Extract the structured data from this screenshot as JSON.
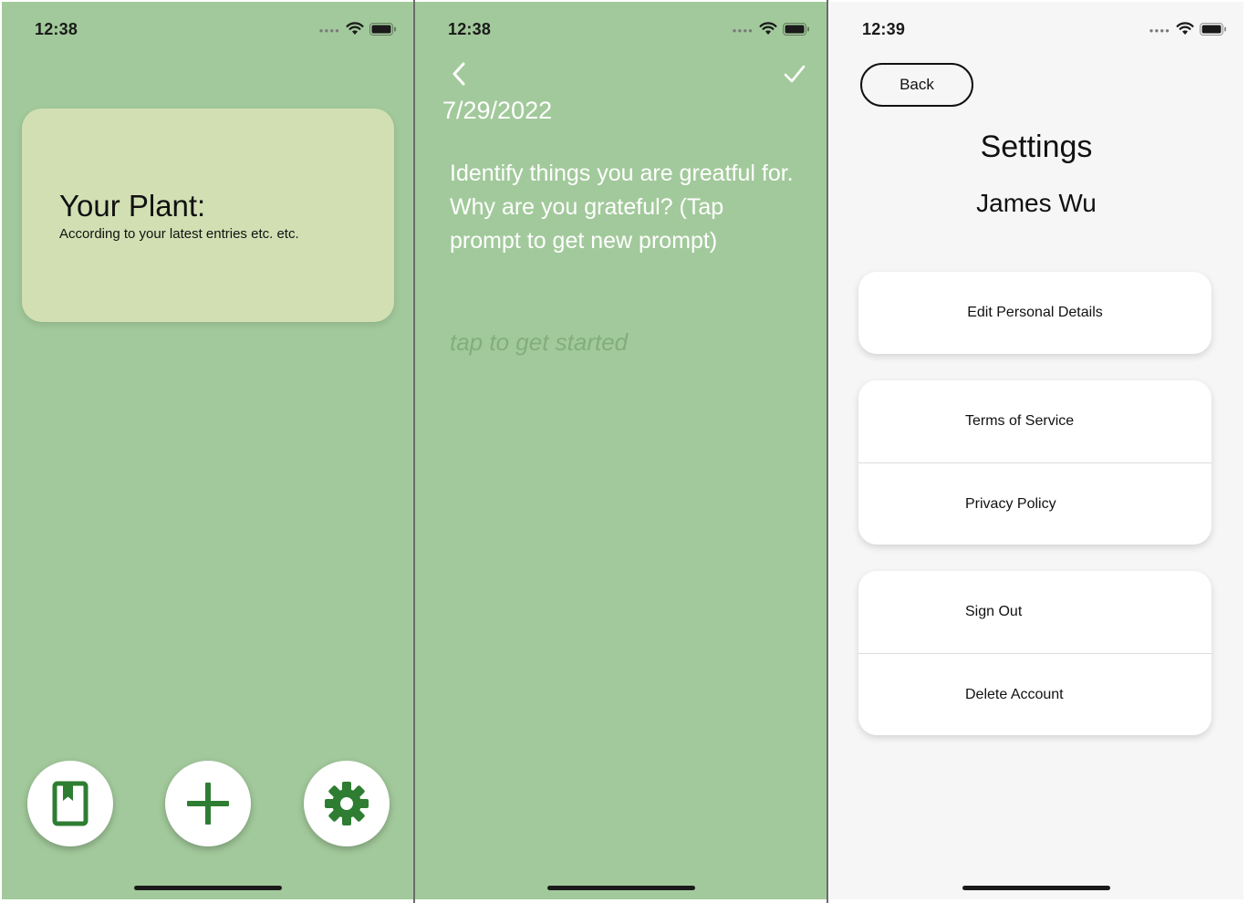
{
  "home_screen": {
    "status_time": "12:38",
    "plant_card": {
      "title": "Your Plant:",
      "subtitle": "According to your latest entries etc. etc."
    },
    "fabs": [
      {
        "icon": "bookmark-book-icon"
      },
      {
        "icon": "plus-icon"
      },
      {
        "icon": "gear-icon"
      }
    ],
    "accent_color": "#2e7d32",
    "background_color": "#a2c99b",
    "card_color": "#d2dfb3"
  },
  "entry_screen": {
    "status_time": "12:38",
    "date": "7/29/2022",
    "prompt": "Identify things you are greatful for. Why are you grateful? (Tap prompt to get new prompt)",
    "input_placeholder": "tap to get started"
  },
  "settings_screen": {
    "status_time": "12:39",
    "back_label": "Back",
    "title": "Settings",
    "user_name": "James Wu",
    "groups": [
      [
        "Edit Personal Details"
      ],
      [
        "Terms of Service",
        "Privacy Policy"
      ],
      [
        "Sign Out",
        "Delete Account"
      ]
    ],
    "background_color": "#f6f6f6"
  }
}
